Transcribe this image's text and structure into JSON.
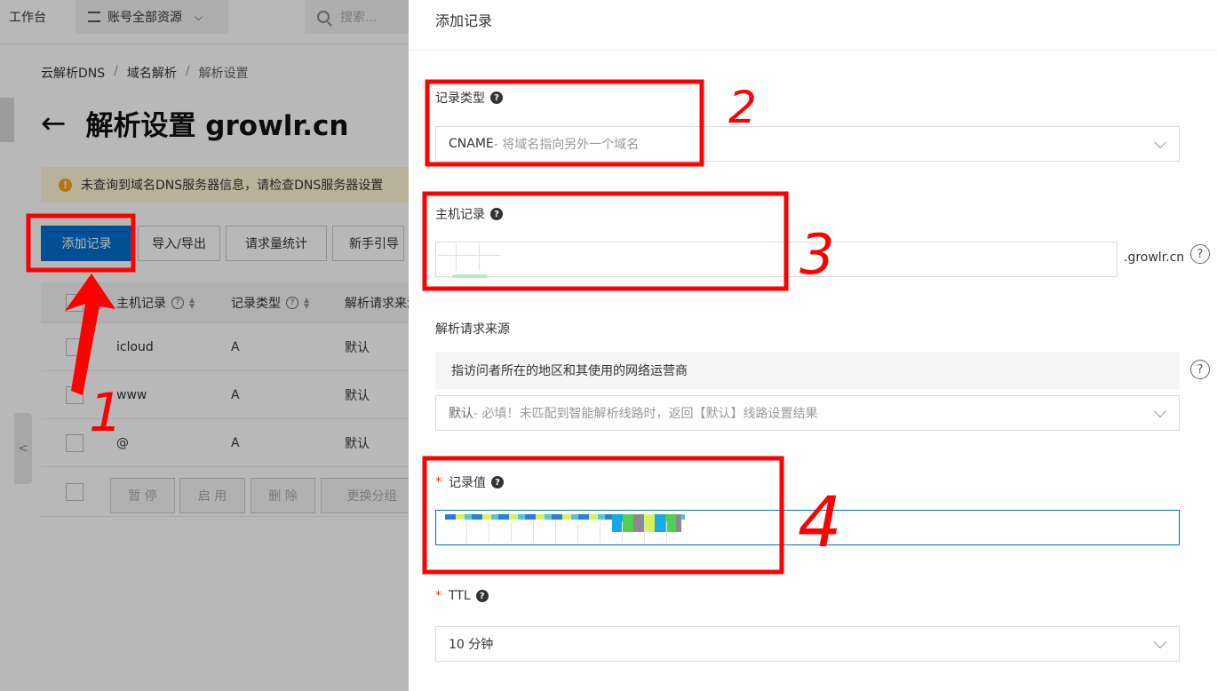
{
  "topbar": {
    "workspace": "工作台",
    "resources": "账号全部资源",
    "search_placeholder": "搜索..."
  },
  "breadcrumb": {
    "items": [
      "云解析DNS",
      "域名解析",
      "解析设置"
    ],
    "sep": "/"
  },
  "page": {
    "back": "←",
    "title": "解析设置 growlr.cn"
  },
  "alert": {
    "text": "未查询到域名DNS服务器信息，请检查DNS服务器设置"
  },
  "actions": {
    "add": "添加记录",
    "import_export": "导入/导出",
    "stats": "请求量统计",
    "guide": "新手引导"
  },
  "table": {
    "headers": [
      "主机记录",
      "记录类型",
      "解析请求来源"
    ],
    "rows": [
      {
        "host": "icloud",
        "type": "A",
        "line": "默认"
      },
      {
        "host": "www",
        "type": "A",
        "line": "默认"
      },
      {
        "host": "@",
        "type": "A",
        "line": "默认"
      }
    ],
    "footer": {
      "pause": "暂 停",
      "enable": "启 用",
      "delete": "删 除",
      "regroup": "更换分组"
    }
  },
  "drawer": {
    "title": "添加记录",
    "record_type": {
      "label": "记录类型",
      "value": "CNAME",
      "hint": "- 将域名指向另外一个域名"
    },
    "host_record": {
      "label": "主机记录",
      "suffix": ".growlr.cn"
    },
    "line": {
      "label": "解析请求来源",
      "desc": "指访问者所在的地区和其使用的网络运营商",
      "value": "默认",
      "hint": " - 必填！未匹配到智能解析线路时，返回【默认】线路设置结果"
    },
    "record_value": {
      "label": "记录值",
      "required": "*"
    },
    "ttl": {
      "label": "TTL",
      "required": "*",
      "value": "10 分钟"
    }
  },
  "annotations": [
    "1",
    "2",
    "3",
    "4"
  ],
  "colors": {
    "primary": "#0070cc",
    "annotation": "#ff0000",
    "required": "#e0301e"
  }
}
